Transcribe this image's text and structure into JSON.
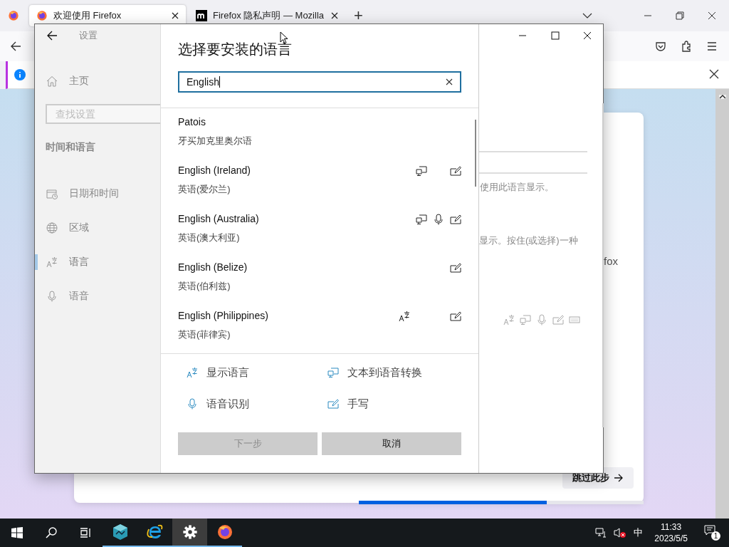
{
  "browser": {
    "tabs": [
      {
        "title": "欢迎使用 Firefox",
        "kind": "firefox",
        "selected": true
      },
      {
        "title": "Firefox 隐私声明 — Mozilla",
        "kind": "mozilla",
        "selected": false
      }
    ],
    "new_tab": "+",
    "page": {
      "fragment_1": "使用此语言显示。",
      "fragment_2": "显示。按住(或选择)一种",
      "fragment_3": "fox",
      "skip_button": "跳过此步",
      "progress": {
        "level": 0.66
      }
    }
  },
  "settings": {
    "title": "设置",
    "home": "主页",
    "search": {
      "placeholder": "查找设置"
    },
    "section": "时间和语言",
    "nav": [
      {
        "label": "日期和时间",
        "kind": "calendar",
        "selected": false
      },
      {
        "label": "区域",
        "kind": "globe",
        "selected": false
      },
      {
        "label": "语言",
        "kind": "language",
        "selected": true
      },
      {
        "label": "语音",
        "kind": "mic",
        "selected": false
      }
    ]
  },
  "dialog": {
    "title": "选择要安装的语言",
    "search": {
      "value": "English"
    },
    "languages": [
      {
        "name": "Patois",
        "native": "牙买加克里奥尔语",
        "display": false,
        "tts": false,
        "speech": false,
        "handwriting": false
      },
      {
        "name": "English (Ireland)",
        "native": "英语(爱尔兰)",
        "display": false,
        "tts": true,
        "speech": false,
        "handwriting": true
      },
      {
        "name": "English (Australia)",
        "native": "英语(澳大利亚)",
        "display": false,
        "tts": true,
        "speech": true,
        "handwriting": true
      },
      {
        "name": "English (Belize)",
        "native": "英语(伯利兹)",
        "display": false,
        "tts": false,
        "speech": false,
        "handwriting": true
      },
      {
        "name": "English (Philippines)",
        "native": "英语(菲律宾)",
        "display": true,
        "tts": false,
        "speech": false,
        "handwriting": true
      }
    ],
    "legend": [
      {
        "label": "显示语言",
        "kind": "display"
      },
      {
        "label": "文本到语音转换",
        "kind": "tts"
      },
      {
        "label": "语音识别",
        "kind": "speech"
      },
      {
        "label": "手写",
        "kind": "handwriting"
      }
    ],
    "buttons": [
      {
        "label": "下一步",
        "disabled": true
      },
      {
        "label": "取消",
        "disabled": false
      }
    ]
  },
  "taskbar": {
    "apps": [
      {
        "kind": "cube",
        "selected": false
      },
      {
        "kind": "ie",
        "selected": false
      },
      {
        "kind": "gear",
        "selected": true
      },
      {
        "kind": "firefox",
        "selected": false
      }
    ],
    "ime": "中",
    "time": "11:33",
    "date": "2023/5/5",
    "notifications": "1"
  }
}
